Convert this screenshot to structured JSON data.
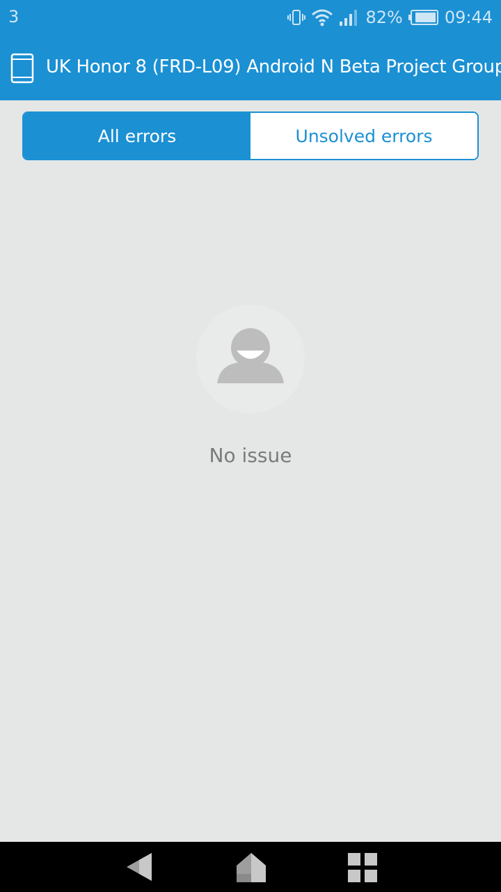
{
  "status_bar": {
    "notification_count": "3",
    "battery_percent": "82%",
    "time": "09:44",
    "icons": [
      "vibrate-icon",
      "wifi-icon",
      "signal-icon",
      "battery-icon"
    ]
  },
  "app_bar": {
    "title": "UK Honor 8 (FRD-L09) Android N Beta Project Group",
    "icon": "device-icon"
  },
  "tabs": [
    {
      "label": "All errors",
      "active": true
    },
    {
      "label": "Unsolved errors",
      "active": false
    }
  ],
  "empty_state": {
    "icon": "smiling-person-icon",
    "text": "No issue"
  },
  "nav_bar": {
    "buttons": [
      "back-icon",
      "home-icon",
      "recent-apps-icon"
    ]
  },
  "colors": {
    "primary": "#1b90d3",
    "background": "#e5e7e7",
    "empty_text": "#7a7a7a"
  }
}
